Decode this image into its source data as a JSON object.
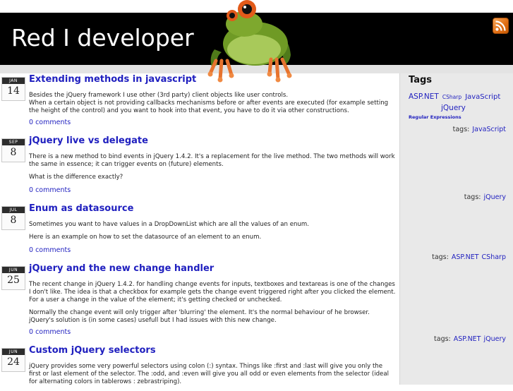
{
  "site": {
    "title": "Red I developer"
  },
  "icons": {
    "rss": "rss-icon",
    "mascot": "frog-mascot"
  },
  "colors": {
    "header_bg": "#000000",
    "link": "#1f1fbf",
    "sidebar_bg": "#e9e9e9"
  },
  "posts": [
    {
      "month": "JAN",
      "day": "14",
      "title": "Extending methods in javascript",
      "paragraphs": [
        "Besides the jQuery framework I use other (3rd party) client objects like user controls.\nWhen a certain object is not providing callbacks mechanisms before or after events are executed (for example setting the height of the control) and you want to hook into that event, you have to do it via other constructions."
      ],
      "comments": "0 comments",
      "tags_label": "tags:",
      "tags": [
        "JavaScript"
      ]
    },
    {
      "month": "SEP",
      "day": "8",
      "title": "jQuery live vs delegate",
      "paragraphs": [
        "There is a new method to bind events in jQuery 1.4.2. It's a replacement for the live method. The two methods will work the same in essence; it can trigger events on (future) elements.",
        "What is the difference exactly?"
      ],
      "comments": "0 comments",
      "tags_label": "tags:",
      "tags": [
        "jQuery"
      ]
    },
    {
      "month": "JUL",
      "day": "8",
      "title": "Enum as datasource",
      "paragraphs": [
        "Sometimes you want to have values in a DropDownList which are all the values of an enum.",
        "Here is an example on how to set the datasource of an element to an enum."
      ],
      "comments": "0 comments",
      "tags_label": "tags:",
      "tags": [
        "ASP.NET",
        "CSharp"
      ]
    },
    {
      "month": "JUN",
      "day": "25",
      "title": "jQuery and the new change handler",
      "paragraphs": [
        "The recent change in jQuery 1.4.2. for handling change events for inputs, textboxes and textareas is one of the changes I don't like. The idea is that a checkbox for example gets the change event triggered right after you clicked the element. For a user a change in the value of the element; it's getting checked or unchecked.",
        "Normally the change event will only trigger after 'blurring' the element. It's the normal behaviour of he browser. jQuery's solution is (in some cases) usefull but I had issues with this new change."
      ],
      "comments": "0 comments",
      "tags_label": "tags:",
      "tags": [
        "ASP.NET",
        "jQuery"
      ]
    },
    {
      "month": "JUN",
      "day": "24",
      "title": "Custom jQuery selectors",
      "paragraphs": [
        "jQuery provides some very powerful selectors using colon (:) syntax. Things like :first and :last will give you only the first or last element of the selector. The :odd, and :even will give you all odd or even elements from the selector (ideal for alternating colors in tablerows : zebrastriping)."
      ]
    }
  ],
  "sidebar": {
    "tags_heading": "Tags",
    "tags": [
      "ASP.NET",
      "CSharp",
      "JavaScript",
      "jQuery",
      "Regular Expressions"
    ]
  }
}
